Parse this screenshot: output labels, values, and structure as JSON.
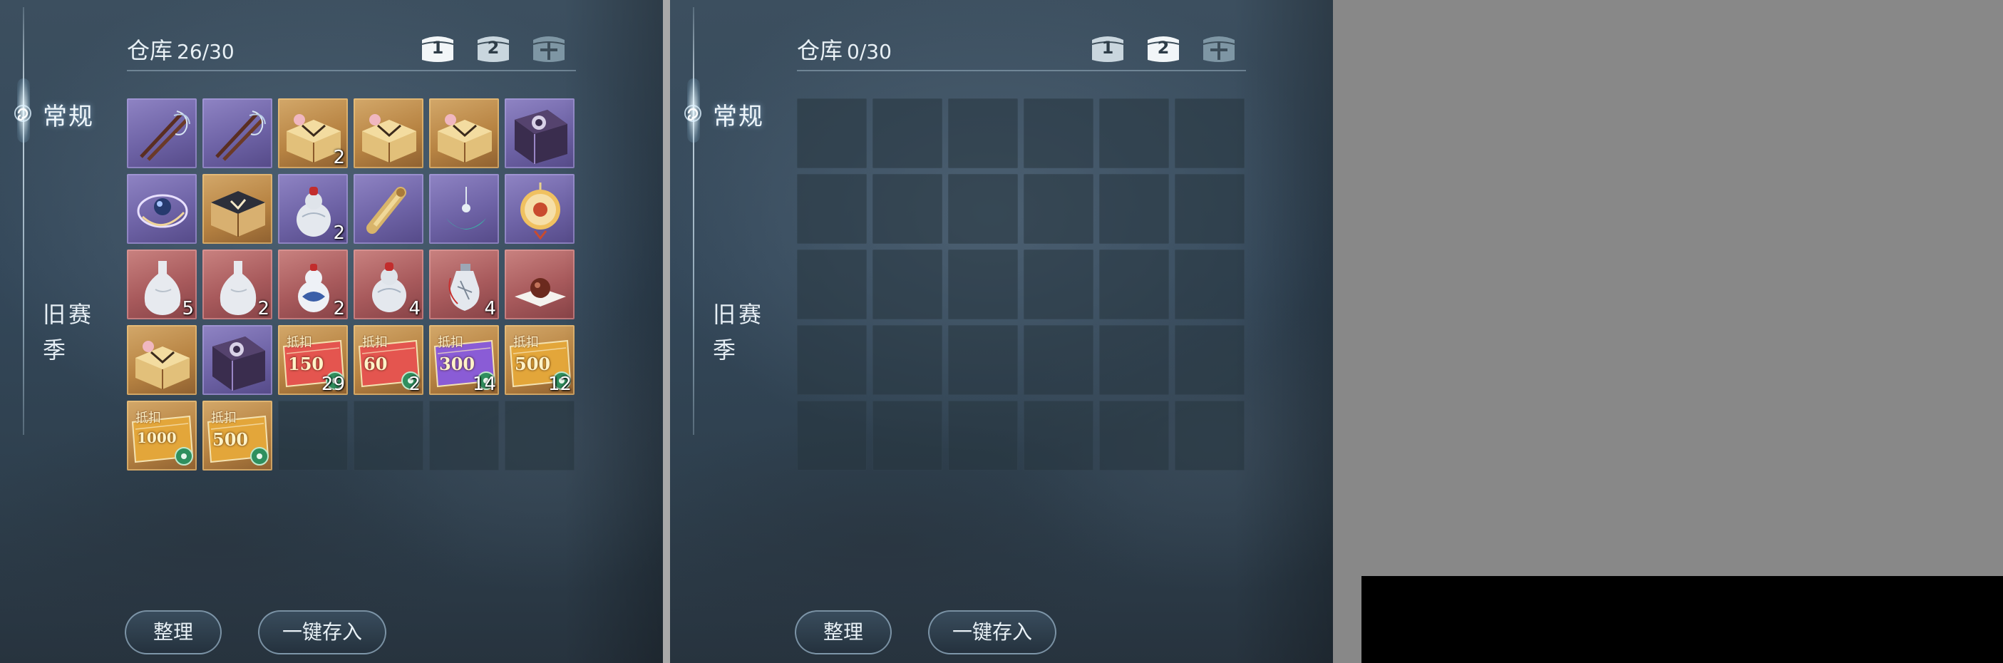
{
  "panels": [
    {
      "sidebar": {
        "tab_general": "常规",
        "tab_old_season": "旧赛季"
      },
      "header": {
        "title": "仓库",
        "count": "26/30",
        "pages": [
          "1",
          "2",
          ""
        ]
      },
      "slots": [
        {
          "item": "fishing-rod",
          "rarity": "purple",
          "qty": ""
        },
        {
          "item": "fishing-rod",
          "rarity": "purple",
          "qty": ""
        },
        {
          "item": "gift-box",
          "rarity": "gold",
          "qty": "2"
        },
        {
          "item": "gift-box",
          "rarity": "gold",
          "qty": ""
        },
        {
          "item": "gift-box",
          "rarity": "gold",
          "qty": ""
        },
        {
          "item": "dark-book",
          "rarity": "purple",
          "qty": ""
        },
        {
          "item": "swirl-orb",
          "rarity": "purple",
          "qty": ""
        },
        {
          "item": "dark-chest",
          "rarity": "gold",
          "qty": ""
        },
        {
          "item": "red-gourd",
          "rarity": "purple",
          "qty": "2"
        },
        {
          "item": "scroll",
          "rarity": "purple",
          "qty": ""
        },
        {
          "item": "pendant",
          "rarity": "purple",
          "qty": ""
        },
        {
          "item": "lantern-tag",
          "rarity": "purple",
          "qty": ""
        },
        {
          "item": "vase",
          "rarity": "red",
          "qty": "5"
        },
        {
          "item": "vase",
          "rarity": "red",
          "qty": "2"
        },
        {
          "item": "blue-gourd",
          "rarity": "red",
          "qty": "2"
        },
        {
          "item": "red-gourd",
          "rarity": "red",
          "qty": "4"
        },
        {
          "item": "bottle",
          "rarity": "red",
          "qty": "4"
        },
        {
          "item": "pill",
          "rarity": "red",
          "qty": ""
        },
        {
          "item": "gift-box",
          "rarity": "gold",
          "qty": ""
        },
        {
          "item": "dark-book",
          "rarity": "purple",
          "qty": ""
        },
        {
          "item": "voucher",
          "rarity": "gold",
          "qty": "29",
          "label": "抵扣",
          "amount": "150",
          "color": "#e4554f"
        },
        {
          "item": "voucher",
          "rarity": "gold",
          "qty": "2",
          "label": "抵扣",
          "amount": "60",
          "color": "#e4554f"
        },
        {
          "item": "voucher",
          "rarity": "gold",
          "qty": "14",
          "label": "抵扣",
          "amount": "300",
          "color": "#8a5cd6"
        },
        {
          "item": "voucher",
          "rarity": "gold",
          "qty": "12",
          "label": "抵扣",
          "amount": "500",
          "color": "#e3a63a"
        },
        {
          "item": "voucher",
          "rarity": "gold",
          "qty": "",
          "label": "抵扣",
          "amount": "1000",
          "color": "#e3a63a"
        },
        {
          "item": "voucher",
          "rarity": "gold",
          "qty": "",
          "label": "抵扣",
          "amount": "500",
          "color": "#e3a63a"
        },
        {
          "item": "empty"
        },
        {
          "item": "empty"
        },
        {
          "item": "empty"
        },
        {
          "item": "empty"
        }
      ],
      "buttons": {
        "sort": "整理",
        "deposit_all": "一键存入"
      }
    },
    {
      "sidebar": {
        "tab_general": "常规",
        "tab_old_season": "旧赛季"
      },
      "header": {
        "title": "仓库",
        "count": "0/30",
        "pages": [
          "1",
          "2",
          ""
        ]
      },
      "slots": [],
      "buttons": {
        "sort": "整理",
        "deposit_all": "一键存入"
      }
    }
  ]
}
